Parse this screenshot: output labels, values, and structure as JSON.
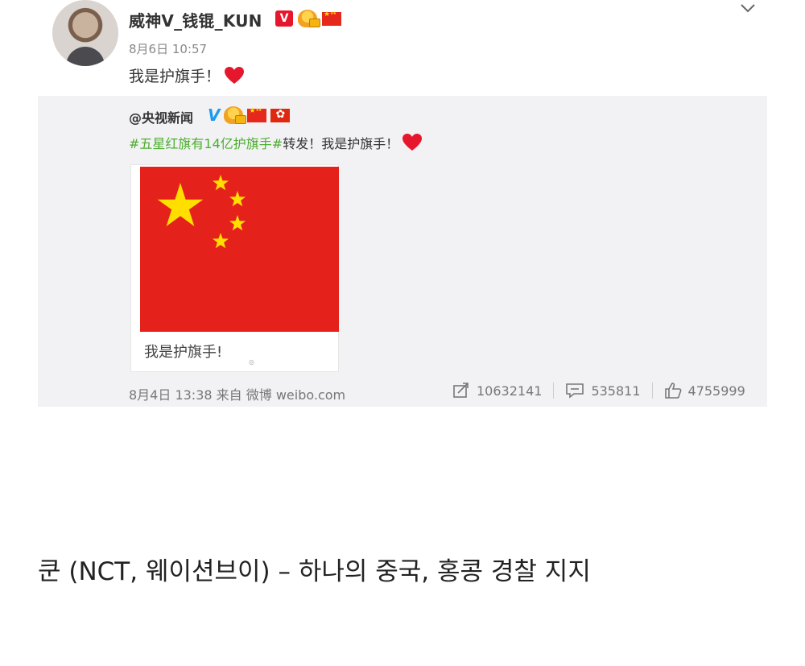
{
  "post": {
    "username": "威神V_钱锟_KUN",
    "verified_badge": "V",
    "time": "8月6日 10:57",
    "text": "我是护旗手！",
    "heart_color": "#e6162d"
  },
  "repost": {
    "original_user": "@央视新闻",
    "hashtag": "#五星红旗有14亿护旗手#",
    "text": "转发！我是护旗手！",
    "media_caption": "我是护旗手!",
    "meta": "8月4日 13:38 来自 微博 weibo.com",
    "reposts": "10632141",
    "comments": "535811",
    "likes": "4755999",
    "flag_red": "#e5211b",
    "flag_yellow": "#ffde00",
    "hashtag_color": "#4cae2c"
  },
  "caption": "쿤 (NCT, 웨이션브이) – 하나의 중국, 홍콩 경찰 지지",
  "icons": [
    "chevron-down-icon",
    "verified-badge-icon",
    "emblem-icon",
    "china-flag-icon",
    "hongkong-flag-icon",
    "heart-icon",
    "repost-icon",
    "comment-icon",
    "like-icon"
  ]
}
